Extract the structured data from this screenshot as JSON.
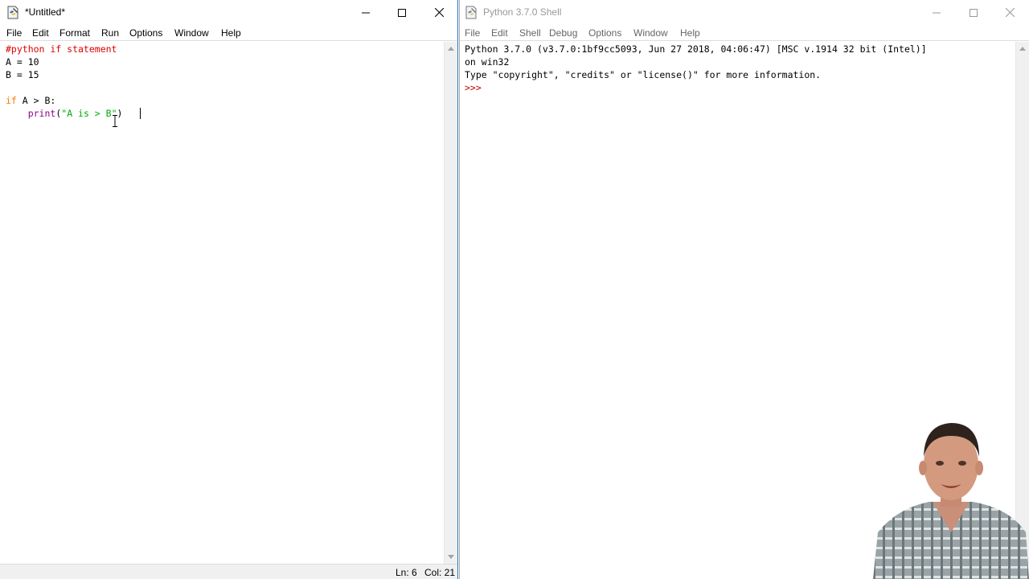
{
  "editor": {
    "title": "*Untitled*",
    "menu": [
      "File",
      "Edit",
      "Format",
      "Run",
      "Options",
      "Window",
      "Help"
    ],
    "code": [
      [
        {
          "t": "#python if statement",
          "c": "c-comment"
        }
      ],
      [
        {
          "t": "A = 10",
          "c": "c-plain"
        }
      ],
      [
        {
          "t": "B = 15",
          "c": "c-plain"
        }
      ],
      [
        {
          "t": "",
          "c": "c-plain"
        }
      ],
      [
        {
          "t": "if",
          "c": "c-kw"
        },
        {
          "t": " A > B:",
          "c": "c-plain"
        }
      ],
      [
        {
          "t": "    ",
          "c": "c-plain"
        },
        {
          "t": "print",
          "c": "c-builtin"
        },
        {
          "t": "(",
          "c": "c-plain"
        },
        {
          "t": "\"A is > B\"",
          "c": "c-str"
        },
        {
          "t": ")",
          "c": "c-plain"
        }
      ]
    ],
    "status": {
      "line": "Ln: 6",
      "col": "Col: 21"
    }
  },
  "shell": {
    "title": "Python 3.7.0 Shell",
    "menu": [
      "File",
      "Edit",
      "Shell",
      "Debug",
      "Options",
      "Window",
      "Help"
    ],
    "output": [
      [
        {
          "t": "Python 3.7.0 (v3.7.0:1bf9cc5093, Jun 27 2018, 04:06:47) [MSC v.1914 32 bit (Intel)]",
          "c": "c-plain"
        }
      ],
      [
        {
          "t": "on win32",
          "c": "c-plain"
        }
      ],
      [
        {
          "t": "Type \"copyright\", \"credits\" or \"license()\" for more information.",
          "c": "c-plain"
        }
      ],
      [
        {
          "t": ">>> ",
          "c": "c-prompt"
        }
      ]
    ]
  },
  "icons": {
    "app": "python-idle-icon",
    "minimize": "minimize-icon",
    "maximize": "maximize-icon",
    "close": "close-icon"
  },
  "colors": {
    "comment": "#dd0000",
    "keyword": "#ff7700",
    "builtin": "#900090",
    "string": "#00aa00",
    "prompt": "#c00000",
    "active_border": "#1979ca"
  }
}
